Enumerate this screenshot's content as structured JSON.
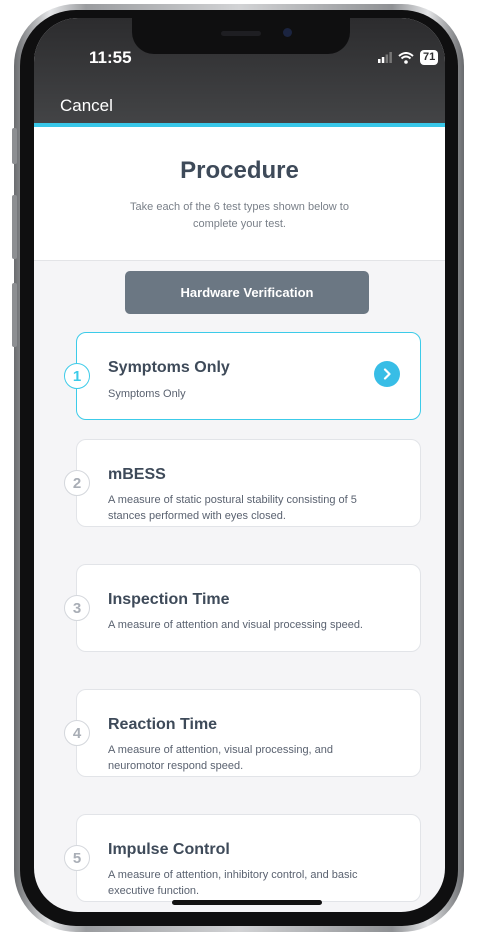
{
  "status_bar": {
    "time": "11:55",
    "battery": "71"
  },
  "nav": {
    "cancel_label": "Cancel"
  },
  "header": {
    "title": "Procedure",
    "subtitle": "Take each of the 6 test types shown below to complete your test."
  },
  "hardware_button_label": "Hardware Verification",
  "tests": [
    {
      "number": "1",
      "title": "Symptoms Only",
      "description": "Symptoms Only"
    },
    {
      "number": "2",
      "title": "mBESS",
      "description": "A measure of static postural stability consisting of 5 stances performed with eyes closed."
    },
    {
      "number": "3",
      "title": "Inspection Time",
      "description": "A measure of attention and visual processing speed."
    },
    {
      "number": "4",
      "title": "Reaction Time",
      "description": "A measure of attention, visual processing, and neuromotor respond speed."
    },
    {
      "number": "5",
      "title": "Impulse Control",
      "description": "A measure of attention, inhibitory control, and basic executive function."
    }
  ],
  "colors": {
    "accent": "#38c7e8",
    "title_text": "#3e4a59",
    "button_bg": "#6b7783",
    "nav_bg": "#2c2c2e"
  }
}
